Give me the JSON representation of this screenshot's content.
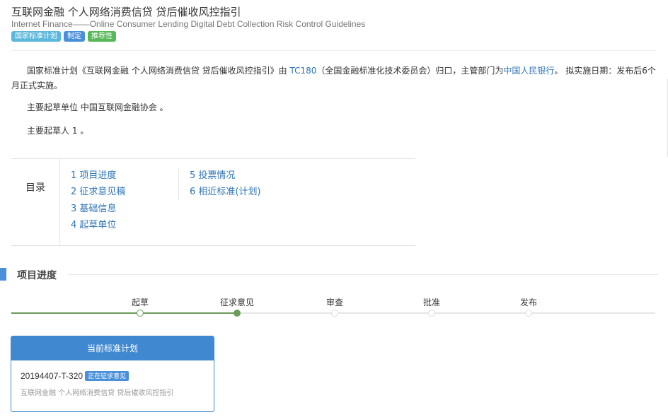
{
  "header": {
    "title": "互联网金融 个人网络消费信贷 贷后催收风控指引",
    "subtitle": "Internet Finance——Online Consumer Lending Digital Debt Collection Risk Control Guidelines",
    "tags": [
      {
        "label": "国家标准计划",
        "color": "#5bb8dc"
      },
      {
        "label": "制定",
        "color": "#4a8fd9"
      },
      {
        "label": "推荐性",
        "color": "#56b856"
      }
    ]
  },
  "intro": {
    "p1_prefix": "国家标准计划《互联网金融 个人网络消费信贷 贷后催收风控指引》由 ",
    "committee_code": "TC180",
    "p1_mid": "（全国金融标准化技术委员会）归口，主管部门为",
    "authority": "中国人民银行",
    "p1_suffix": "。 拟实施日期：发布后6个月正式实施。",
    "p2": "主要起草单位 中国互联网金融协会 。",
    "p3": "主要起草人 1 。"
  },
  "toc": {
    "label": "目录",
    "items": [
      "1  项目进度",
      "2  征求意见稿",
      "3  基础信息",
      "4  起草单位",
      "5  投票情况",
      "6  相近标准(计划)"
    ]
  },
  "progress": {
    "section_title": "项目进度",
    "stages": [
      "起草",
      "征求意见",
      "审查",
      "批准",
      "发布"
    ],
    "current_index": 1
  },
  "current_plan": {
    "header": "当前标准计划",
    "code": "20194407-T-320",
    "status": "正在征求意见",
    "name": "互联网金融 个人网络消费信贷 贷后催收风控指引"
  }
}
